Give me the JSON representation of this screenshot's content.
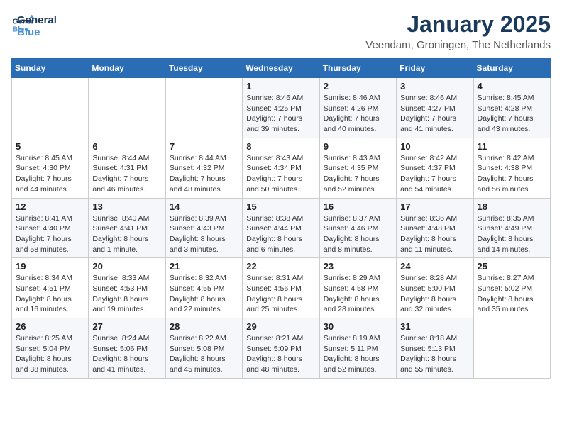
{
  "header": {
    "logo_line1": "General",
    "logo_line2": "Blue",
    "month": "January 2025",
    "location": "Veendam, Groningen, The Netherlands"
  },
  "weekdays": [
    "Sunday",
    "Monday",
    "Tuesday",
    "Wednesday",
    "Thursday",
    "Friday",
    "Saturday"
  ],
  "weeks": [
    [
      {
        "day": "",
        "info": ""
      },
      {
        "day": "",
        "info": ""
      },
      {
        "day": "",
        "info": ""
      },
      {
        "day": "1",
        "info": "Sunrise: 8:46 AM\nSunset: 4:25 PM\nDaylight: 7 hours and 39 minutes."
      },
      {
        "day": "2",
        "info": "Sunrise: 8:46 AM\nSunset: 4:26 PM\nDaylight: 7 hours and 40 minutes."
      },
      {
        "day": "3",
        "info": "Sunrise: 8:46 AM\nSunset: 4:27 PM\nDaylight: 7 hours and 41 minutes."
      },
      {
        "day": "4",
        "info": "Sunrise: 8:45 AM\nSunset: 4:28 PM\nDaylight: 7 hours and 43 minutes."
      }
    ],
    [
      {
        "day": "5",
        "info": "Sunrise: 8:45 AM\nSunset: 4:30 PM\nDaylight: 7 hours and 44 minutes."
      },
      {
        "day": "6",
        "info": "Sunrise: 8:44 AM\nSunset: 4:31 PM\nDaylight: 7 hours and 46 minutes."
      },
      {
        "day": "7",
        "info": "Sunrise: 8:44 AM\nSunset: 4:32 PM\nDaylight: 7 hours and 48 minutes."
      },
      {
        "day": "8",
        "info": "Sunrise: 8:43 AM\nSunset: 4:34 PM\nDaylight: 7 hours and 50 minutes."
      },
      {
        "day": "9",
        "info": "Sunrise: 8:43 AM\nSunset: 4:35 PM\nDaylight: 7 hours and 52 minutes."
      },
      {
        "day": "10",
        "info": "Sunrise: 8:42 AM\nSunset: 4:37 PM\nDaylight: 7 hours and 54 minutes."
      },
      {
        "day": "11",
        "info": "Sunrise: 8:42 AM\nSunset: 4:38 PM\nDaylight: 7 hours and 56 minutes."
      }
    ],
    [
      {
        "day": "12",
        "info": "Sunrise: 8:41 AM\nSunset: 4:40 PM\nDaylight: 7 hours and 58 minutes."
      },
      {
        "day": "13",
        "info": "Sunrise: 8:40 AM\nSunset: 4:41 PM\nDaylight: 8 hours and 1 minute."
      },
      {
        "day": "14",
        "info": "Sunrise: 8:39 AM\nSunset: 4:43 PM\nDaylight: 8 hours and 3 minutes."
      },
      {
        "day": "15",
        "info": "Sunrise: 8:38 AM\nSunset: 4:44 PM\nDaylight: 8 hours and 6 minutes."
      },
      {
        "day": "16",
        "info": "Sunrise: 8:37 AM\nSunset: 4:46 PM\nDaylight: 8 hours and 8 minutes."
      },
      {
        "day": "17",
        "info": "Sunrise: 8:36 AM\nSunset: 4:48 PM\nDaylight: 8 hours and 11 minutes."
      },
      {
        "day": "18",
        "info": "Sunrise: 8:35 AM\nSunset: 4:49 PM\nDaylight: 8 hours and 14 minutes."
      }
    ],
    [
      {
        "day": "19",
        "info": "Sunrise: 8:34 AM\nSunset: 4:51 PM\nDaylight: 8 hours and 16 minutes."
      },
      {
        "day": "20",
        "info": "Sunrise: 8:33 AM\nSunset: 4:53 PM\nDaylight: 8 hours and 19 minutes."
      },
      {
        "day": "21",
        "info": "Sunrise: 8:32 AM\nSunset: 4:55 PM\nDaylight: 8 hours and 22 minutes."
      },
      {
        "day": "22",
        "info": "Sunrise: 8:31 AM\nSunset: 4:56 PM\nDaylight: 8 hours and 25 minutes."
      },
      {
        "day": "23",
        "info": "Sunrise: 8:29 AM\nSunset: 4:58 PM\nDaylight: 8 hours and 28 minutes."
      },
      {
        "day": "24",
        "info": "Sunrise: 8:28 AM\nSunset: 5:00 PM\nDaylight: 8 hours and 32 minutes."
      },
      {
        "day": "25",
        "info": "Sunrise: 8:27 AM\nSunset: 5:02 PM\nDaylight: 8 hours and 35 minutes."
      }
    ],
    [
      {
        "day": "26",
        "info": "Sunrise: 8:25 AM\nSunset: 5:04 PM\nDaylight: 8 hours and 38 minutes."
      },
      {
        "day": "27",
        "info": "Sunrise: 8:24 AM\nSunset: 5:06 PM\nDaylight: 8 hours and 41 minutes."
      },
      {
        "day": "28",
        "info": "Sunrise: 8:22 AM\nSunset: 5:08 PM\nDaylight: 8 hours and 45 minutes."
      },
      {
        "day": "29",
        "info": "Sunrise: 8:21 AM\nSunset: 5:09 PM\nDaylight: 8 hours and 48 minutes."
      },
      {
        "day": "30",
        "info": "Sunrise: 8:19 AM\nSunset: 5:11 PM\nDaylight: 8 hours and 52 minutes."
      },
      {
        "day": "31",
        "info": "Sunrise: 8:18 AM\nSunset: 5:13 PM\nDaylight: 8 hours and 55 minutes."
      },
      {
        "day": "",
        "info": ""
      }
    ]
  ]
}
